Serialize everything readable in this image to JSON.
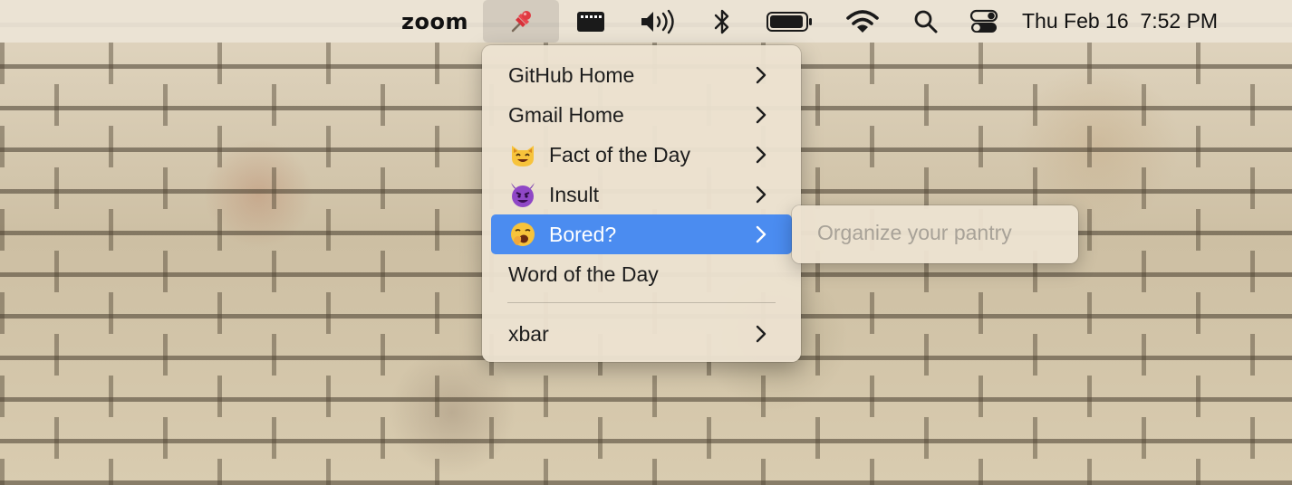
{
  "menubar": {
    "app_label": "zoom",
    "pin_icon": "pushpin-icon",
    "icons": [
      "display-icon",
      "volume-icon",
      "bluetooth-icon",
      "battery-icon",
      "wifi-icon",
      "search-icon",
      "control-center-icon"
    ],
    "datetime": "Thu Feb 16  7:52 PM"
  },
  "menu": {
    "items": [
      {
        "label": "GitHub Home",
        "emoji": "",
        "has_submenu": true
      },
      {
        "label": "Gmail Home",
        "emoji": "",
        "has_submenu": true
      },
      {
        "label": "Fact of the Day",
        "emoji": "smiling-cat-emoji",
        "has_submenu": true
      },
      {
        "label": "Insult",
        "emoji": "smiling-devil-emoji",
        "has_submenu": true
      },
      {
        "label": "Bored?",
        "emoji": "yawning-face-emoji",
        "has_submenu": true,
        "active": true
      },
      {
        "label": "Word of the Day",
        "emoji": "",
        "has_submenu": false
      },
      {
        "label": "xbar",
        "emoji": "",
        "has_submenu": true
      }
    ]
  },
  "submenu": {
    "item_label": "Organize your pantry"
  },
  "colors": {
    "highlight": "#4b8cf0",
    "disabled_text": "#a8a298"
  }
}
